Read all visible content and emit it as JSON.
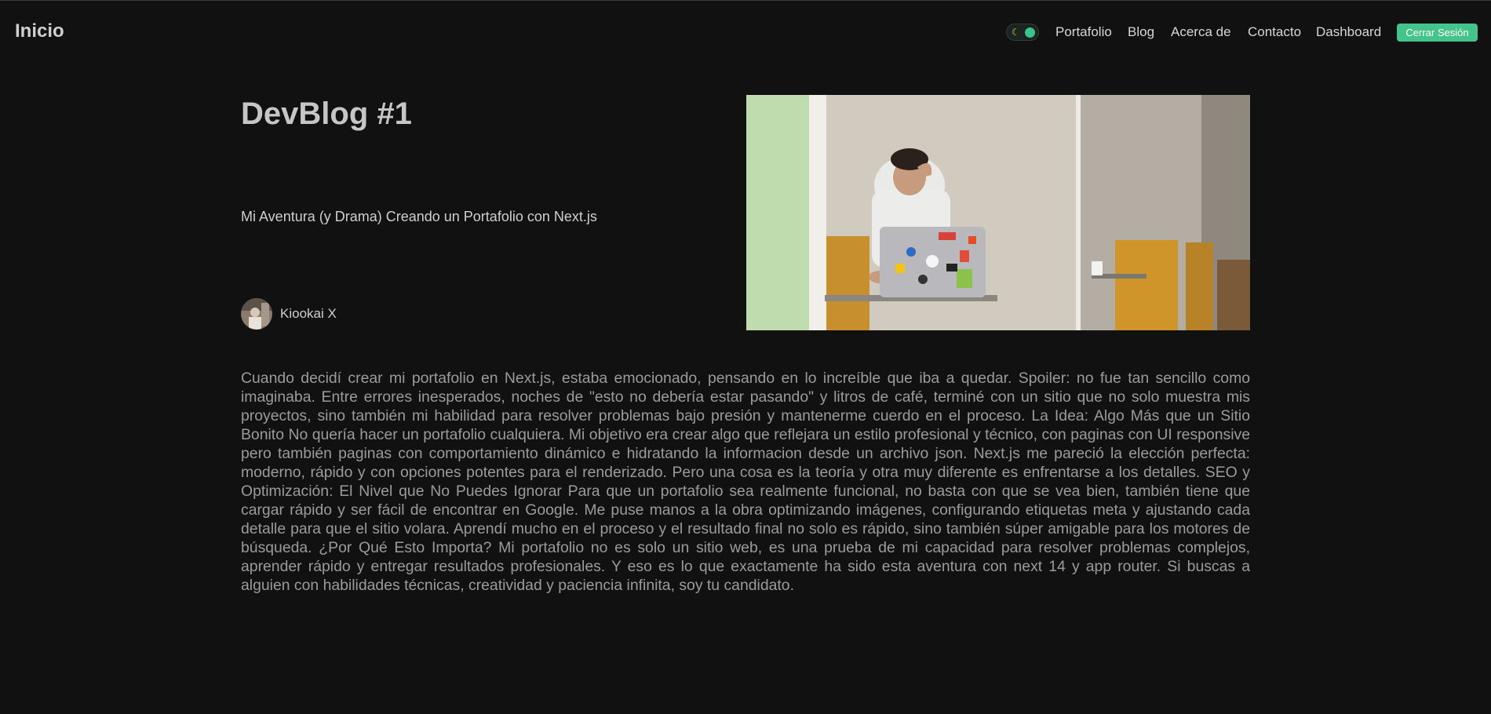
{
  "nav": {
    "logo": "Inicio",
    "theme_toggle_icon": "moon-icon",
    "links": [
      "Portafolio",
      "Blog",
      "Acerca de",
      "Contacto",
      "Dashboard"
    ],
    "logout_label": "Cerrar Sesión"
  },
  "post": {
    "title": "DevBlog #1",
    "subtitle": "Mi Aventura (y Drama) Creando un Portafolio con Next.js",
    "author": "Kiookai X",
    "body": "Cuando decidí crear mi portafolio en Next.js, estaba emocionado, pensando en lo increíble que iba a quedar. Spoiler: no fue tan sencillo como imaginaba. Entre errores inesperados, noches de \"esto no debería estar pasando\" y litros de café, terminé con un sitio que no solo muestra mis proyectos, sino también mi habilidad para resolver problemas bajo presión y mantenerme cuerdo en el proceso. La Idea: Algo Más que un Sitio Bonito No quería hacer un portafolio cualquiera. Mi objetivo era crear algo que reflejara un estilo profesional y técnico, con paginas con UI responsive pero también paginas con comportamiento dinámico e hidratando la informacion desde un archivo json. Next.js me pareció la elección perfecta: moderno, rápido y con opciones potentes para el renderizado. Pero una cosa es la teoría y otra muy diferente es enfrentarse a los detalles. SEO y Optimización: El Nivel que No Puedes Ignorar Para que un portafolio sea realmente funcional, no basta con que se vea bien, también tiene que cargar rápido y ser fácil de encontrar en Google. Me puse manos a la obra optimizando imágenes, configurando etiquetas meta y ajustando cada detalle para que el sitio volara. Aprendí mucho en el proceso y el resultado final no solo es rápido, sino también súper amigable para los motores de búsqueda. ¿Por Qué Esto Importa? Mi portafolio no es solo un sitio web, es una prueba de mi capacidad para resolver problemas complejos, aprender rápido y entregar resultados profesionales. Y eso es lo que exactamente ha sido esta aventura con next 14 y app router. Si buscas a alguien con habilidades técnicas, creatividad y paciencia infinita, soy tu candidato."
  },
  "colors": {
    "background": "#111111",
    "accent": "#44c38a",
    "title": "#c6c6c6",
    "body_text": "#9b9b9b"
  }
}
